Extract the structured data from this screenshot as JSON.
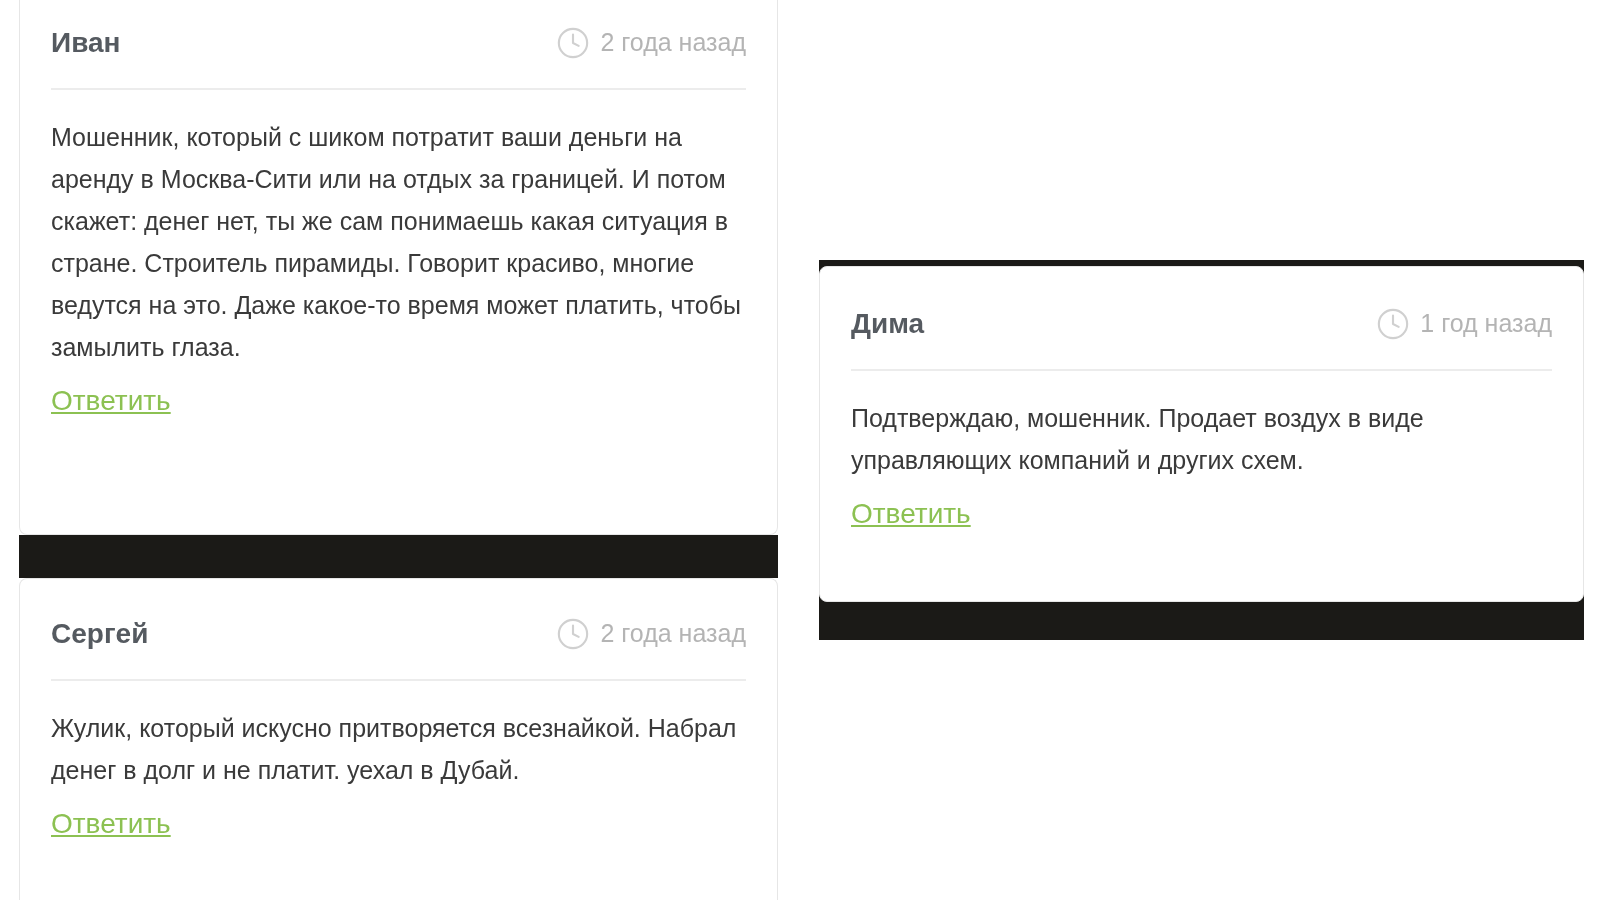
{
  "left_column": {
    "comments": [
      {
        "author": "Иван",
        "time": "2 года назад",
        "text": "Мошенник, который с шиком потратит ваши деньги на аренду в Москва-Сити или на отдых за границей. И потом скажет: денег нет, ты же сам понимаешь какая ситуация в стране. Строитель пирамиды. Говорит красиво, многие ведутся на это. Даже какое-то время может платить, чтобы замылить глаза.",
        "reply": "Ответить"
      },
      {
        "author": "Сергей",
        "time": "2 года назад",
        "text": "Жулик, который искусно притворяется всезнайкой. Набрал денег в долг и не платит. уехал в Дубай.",
        "reply": "Ответить"
      }
    ]
  },
  "right_column": {
    "comments": [
      {
        "author": "Дима",
        "time": "1 год назад",
        "text": "Подтверждаю, мошенник. Продает воздух в виде управляющих компаний и других схем.",
        "reply": "Ответить"
      }
    ]
  }
}
